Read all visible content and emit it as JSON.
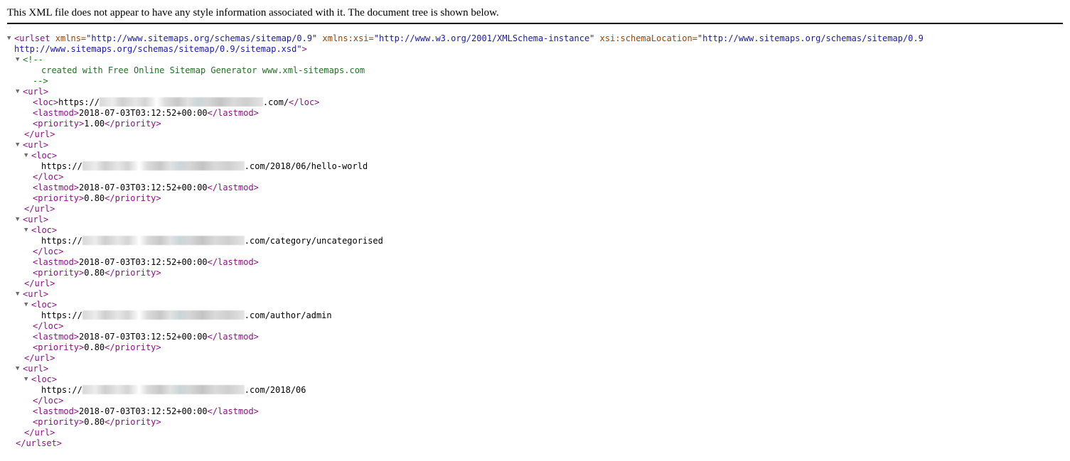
{
  "header": {
    "message": "This XML file does not appear to have any style information associated with it. The document tree is shown below."
  },
  "icons": {
    "expand": "triangle-down-icon"
  },
  "glyphs": {
    "arrow": "▼"
  },
  "xml": {
    "urlset_open_tag": "<urlset",
    "attr_xmlns": " xmlns=",
    "val_xmlns": "\"http://www.sitemaps.org/schemas/sitemap/0.9\"",
    "attr_xsi": " xmlns:xsi=",
    "val_xsi": "\"http://www.w3.org/2001/XMLSchema-instance\"",
    "attr_schema": " xsi:schemaLocation=",
    "val_schema_1": "\"http://www.sitemaps.org/schemas/sitemap/0.9",
    "val_schema_2": "http://www.sitemaps.org/schemas/sitemap/0.9/sitemap.xsd\"",
    "gt": ">",
    "comment_open": "<!--",
    "comment_text": "created with Free Online Sitemap Generator www.xml-sitemaps.com",
    "comment_close": "-->",
    "url_open": "<url>",
    "url_close": "</url>",
    "loc_open": "<loc>",
    "loc_close": "</loc>",
    "lastmod_open": "<lastmod>",
    "lastmod_close": "</lastmod>",
    "priority_open": "<priority>",
    "priority_close": "</priority>",
    "urlset_close": "</urlset>"
  },
  "urls": [
    {
      "loc_prefix": "https://",
      "loc_suffix": ".com/",
      "lastmod": "2018-07-03T03:12:52+00:00",
      "priority": "1.00"
    },
    {
      "loc_prefix": "https://",
      "loc_suffix": ".com/2018/06/hello-world",
      "lastmod": "2018-07-03T03:12:52+00:00",
      "priority": "0.80"
    },
    {
      "loc_prefix": "https://",
      "loc_suffix": ".com/category/uncategorised",
      "lastmod": "2018-07-03T03:12:52+00:00",
      "priority": "0.80"
    },
    {
      "loc_prefix": "https://",
      "loc_suffix": ".com/author/admin",
      "lastmod": "2018-07-03T03:12:52+00:00",
      "priority": "0.80"
    },
    {
      "loc_prefix": "https://",
      "loc_suffix": ".com/2018/06",
      "lastmod": "2018-07-03T03:12:52+00:00",
      "priority": "0.80"
    }
  ]
}
